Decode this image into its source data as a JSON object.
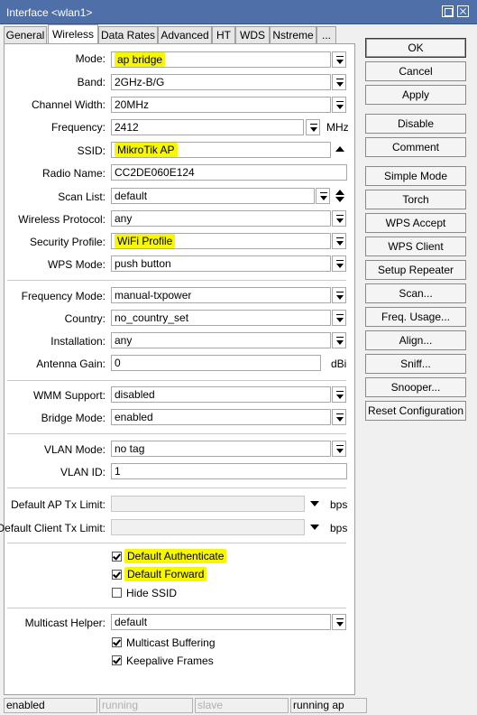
{
  "window": {
    "title": "Interface <wlan1>"
  },
  "tabs": [
    "General",
    "Wireless",
    "Data Rates",
    "Advanced",
    "HT",
    "WDS",
    "Nstreme",
    "..."
  ],
  "form": {
    "mode": {
      "label": "Mode:",
      "value": "ap bridge"
    },
    "band": {
      "label": "Band:",
      "value": "2GHz-B/G"
    },
    "channel_width": {
      "label": "Channel Width:",
      "value": "20MHz"
    },
    "frequency": {
      "label": "Frequency:",
      "value": "2412",
      "unit": "MHz"
    },
    "ssid": {
      "label": "SSID:",
      "value": "MikroTik AP"
    },
    "radio_name": {
      "label": "Radio Name:",
      "value": "CC2DE060E124"
    },
    "scan_list": {
      "label": "Scan List:",
      "value": "default"
    },
    "wireless_protocol": {
      "label": "Wireless Protocol:",
      "value": "any"
    },
    "security_profile": {
      "label": "Security Profile:",
      "value": "WiFi Profile"
    },
    "wps_mode": {
      "label": "WPS Mode:",
      "value": "push button"
    },
    "frequency_mode": {
      "label": "Frequency Mode:",
      "value": "manual-txpower"
    },
    "country": {
      "label": "Country:",
      "value": "no_country_set"
    },
    "installation": {
      "label": "Installation:",
      "value": "any"
    },
    "antenna_gain": {
      "label": "Antenna Gain:",
      "value": "0",
      "unit": "dBi"
    },
    "wmm_support": {
      "label": "WMM Support:",
      "value": "disabled"
    },
    "bridge_mode": {
      "label": "Bridge Mode:",
      "value": "enabled"
    },
    "vlan_mode": {
      "label": "VLAN Mode:",
      "value": "no tag"
    },
    "vlan_id": {
      "label": "VLAN ID:",
      "value": "1"
    },
    "default_ap_tx_limit": {
      "label": "Default AP Tx Limit:",
      "value": "",
      "unit": "bps"
    },
    "default_client_tx_limit": {
      "label": "Default Client Tx Limit:",
      "value": "",
      "unit": "bps"
    },
    "default_authenticate": {
      "label": "Default Authenticate",
      "checked": true
    },
    "default_forward": {
      "label": "Default Forward",
      "checked": true
    },
    "hide_ssid": {
      "label": "Hide SSID",
      "checked": false
    },
    "multicast_helper": {
      "label": "Multicast Helper:",
      "value": "default"
    },
    "multicast_buffering": {
      "label": "Multicast Buffering",
      "checked": true
    },
    "keepalive_frames": {
      "label": "Keepalive Frames",
      "checked": true
    }
  },
  "buttons": [
    "OK",
    "Cancel",
    "Apply",
    "Disable",
    "Comment",
    "Simple Mode",
    "Torch",
    "WPS Accept",
    "WPS Client",
    "Setup Repeater",
    "Scan...",
    "Freq. Usage...",
    "Align...",
    "Sniff...",
    "Snooper...",
    "Reset Configuration"
  ],
  "status": [
    "enabled",
    "running",
    "slave",
    "running ap"
  ],
  "colors": {
    "titlebar": "#4f6fa8",
    "highlight": "#f7f700"
  }
}
